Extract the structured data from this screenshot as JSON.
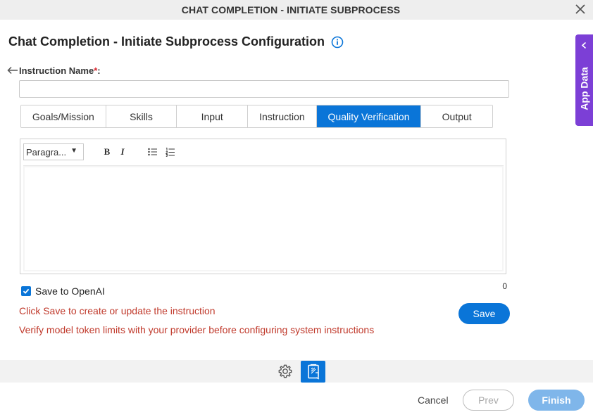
{
  "window": {
    "title": "CHAT COMPLETION - INITIATE SUBPROCESS"
  },
  "page": {
    "heading": "Chat Completion - Initiate Subprocess Configuration"
  },
  "form": {
    "instruction_name_label": "Instruction Name",
    "required_mark": "*",
    "label_suffix": ":",
    "instruction_name_value": "",
    "instruction_name_placeholder": ""
  },
  "tabs": [
    {
      "label": "Goals/Mission",
      "active": false
    },
    {
      "label": "Skills",
      "active": false
    },
    {
      "label": "Input",
      "active": false
    },
    {
      "label": "Instruction",
      "active": false
    },
    {
      "label": "Quality Verification",
      "active": true
    },
    {
      "label": "Output",
      "active": false
    }
  ],
  "editor": {
    "paragraph_select": "Paragra...",
    "bold_label": "B",
    "italic_label": "I",
    "char_count": "0"
  },
  "options": {
    "save_to_openai_label": "Save to OpenAI",
    "save_to_openai_checked": true
  },
  "messages": {
    "save_hint": "Click Save to create or update the instruction",
    "token_hint": "Verify model token limits with your provider before configuring system instructions"
  },
  "buttons": {
    "save": "Save",
    "cancel": "Cancel",
    "prev": "Prev",
    "finish": "Finish"
  },
  "side_panel": {
    "label": "App Data"
  },
  "colors": {
    "accent": "#0a75d8",
    "side_panel": "#7c3fd6",
    "error_text": "#c0392b",
    "finish_disabled": "#7fb6ea"
  },
  "icons": {
    "close": "close-icon",
    "info": "info-icon",
    "back": "arrow-left-icon",
    "gear": "gear-icon",
    "document": "document-icon",
    "chevron": "chevron-left-icon"
  }
}
